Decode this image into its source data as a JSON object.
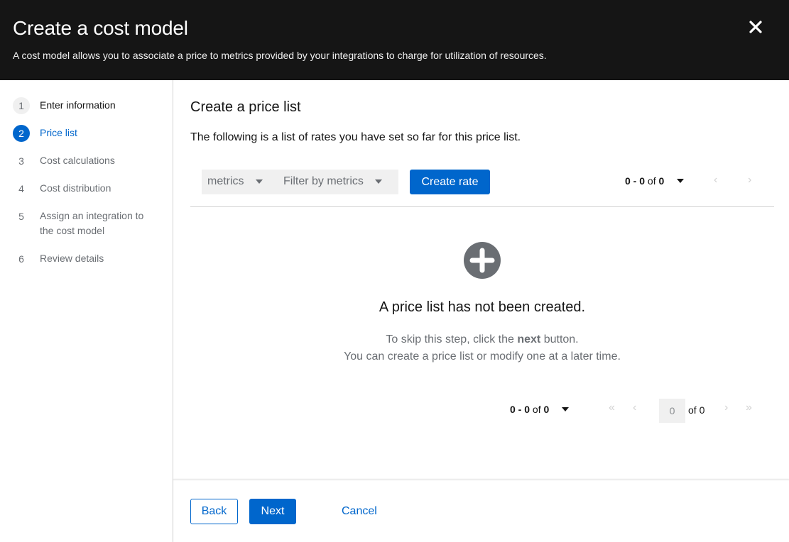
{
  "header": {
    "title": "Create a cost model",
    "description": "A cost model allows you to associate a price to metrics provided by your integrations to charge for utilization of resources."
  },
  "steps": [
    {
      "number": "1",
      "label": "Enter information",
      "state": "done"
    },
    {
      "number": "2",
      "label": "Price list",
      "state": "current"
    },
    {
      "number": "3",
      "label": "Cost calculations",
      "state": "pending"
    },
    {
      "number": "4",
      "label": "Cost distribution",
      "state": "pending"
    },
    {
      "number": "5",
      "label": "Assign an integration to the cost model",
      "state": "pending"
    },
    {
      "number": "6",
      "label": "Review details",
      "state": "pending"
    }
  ],
  "main": {
    "title": "Create a price list",
    "intro": "The following is a list of rates you have set so far for this price list."
  },
  "toolbar": {
    "filter_category": "metrics",
    "filter_placeholder": "Filter by metrics",
    "create_rate_label": "Create rate",
    "pagination": {
      "range": "0 - 0",
      "of_word": "of",
      "total": "0"
    }
  },
  "empty_state": {
    "title": "A price list has not been created.",
    "line1_prefix": "To skip this step, click the ",
    "line1_bold": "next",
    "line1_suffix": " button.",
    "line2": "You can create a price list or modify one at a later time."
  },
  "bottom_pagination": {
    "range": "0 - 0",
    "of_word": "of",
    "total": "0",
    "page_value": "0",
    "of_pages": "of 0"
  },
  "footer": {
    "back_label": "Back",
    "next_label": "Next",
    "cancel_label": "Cancel"
  },
  "colors": {
    "accent": "#0066cc",
    "header_bg": "#151515",
    "muted": "#6a6e73"
  }
}
